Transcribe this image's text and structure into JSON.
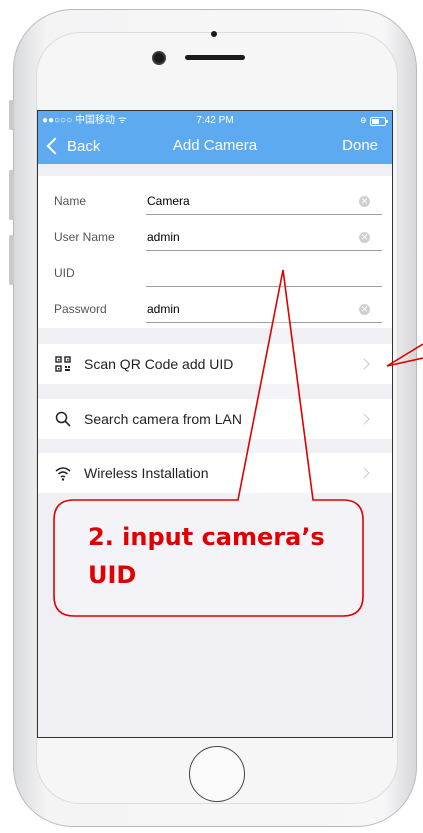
{
  "status_bar": {
    "carrier": "●●○○○ 中国移动 ᯤ",
    "time": "7:42 PM",
    "extra": "ɵ"
  },
  "nav": {
    "back_label": "Back",
    "title": "Add Camera",
    "done_label": "Done"
  },
  "form": {
    "fields": [
      {
        "label": "Name",
        "value": "Camera",
        "clear": true
      },
      {
        "label": "User Name",
        "value": "admin",
        "clear": true
      },
      {
        "label": "UID",
        "value": "",
        "clear": false
      },
      {
        "label": "Password",
        "value": "admin",
        "clear": true
      }
    ]
  },
  "actions": [
    {
      "icon": "qr-code-icon",
      "label": "Scan QR Code add UID"
    },
    {
      "icon": "search-icon",
      "label": "Search camera from LAN"
    },
    {
      "icon": "wifi-icon",
      "label": "Wireless Installation"
    }
  ],
  "annotation": {
    "text": "2. input camera’s UID"
  },
  "colors": {
    "accent": "#5eaaf0",
    "annotation": "#e00000"
  }
}
